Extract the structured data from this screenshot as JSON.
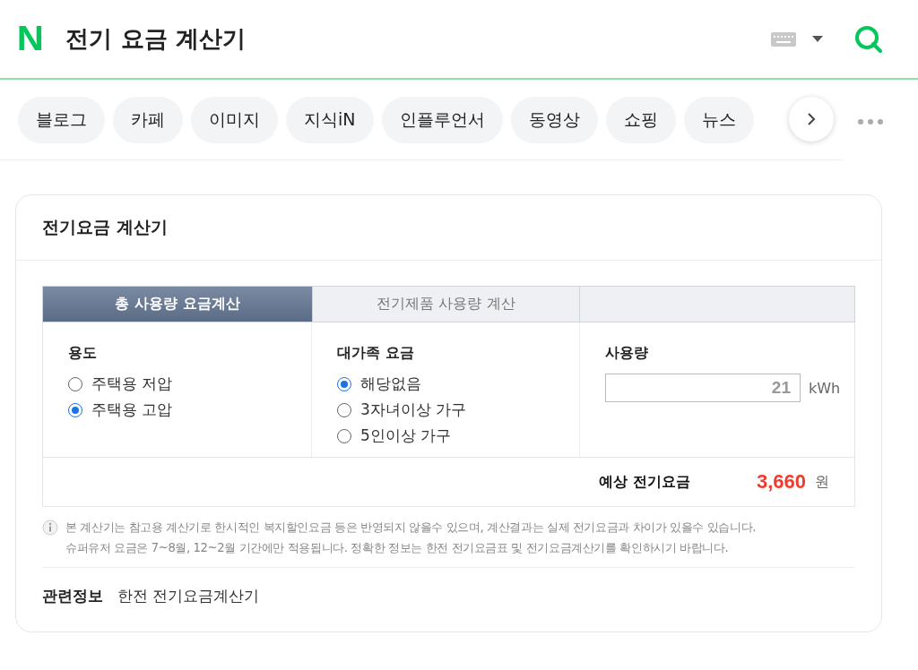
{
  "header": {
    "logo": "N",
    "query": "전기 요금 계산기"
  },
  "chips": [
    {
      "label": "블로그"
    },
    {
      "label": "카페"
    },
    {
      "label": "이미지"
    },
    {
      "label": "지식iN"
    },
    {
      "label": "인플루언서"
    },
    {
      "label": "동영상"
    },
    {
      "label": "쇼핑"
    },
    {
      "label": "뉴스"
    }
  ],
  "card": {
    "title": "전기요금 계산기",
    "tabs": [
      {
        "label": "총 사용량 요금계산",
        "selected": true
      },
      {
        "label": "전기제품 사용량 계산",
        "selected": false
      },
      {
        "selected": false
      }
    ],
    "usage_type": {
      "label": "용도",
      "options": [
        {
          "label": "주택용 저압",
          "selected": false
        },
        {
          "label": "주택용 고압",
          "selected": true
        }
      ]
    },
    "family": {
      "label": "대가족 요금",
      "options": [
        {
          "label": "해당없음",
          "selected": true
        },
        {
          "label": "3자녀이상 가구",
          "selected": false
        },
        {
          "label": "5인이상 가구",
          "selected": false
        }
      ]
    },
    "amount": {
      "label": "사용량",
      "value": "21",
      "unit": "kWh"
    },
    "result": {
      "label": "예상 전기요금",
      "value": "3,660",
      "unit": "원"
    },
    "notes": [
      "본 계산기는 참고용 계산기로 한시적인 복지할인요금 등은 반영되지 않을수 있으며, 계산결과는 실제 전기요금과 차이가 있을수 있습니다.",
      "슈퍼유저 요금은 7~8월, 12~2월 기간에만 적용됩니다. 정확한 정보는 한전 전기요금표 및 전기요금계산기를 확인하시기 바랍니다."
    ],
    "related": {
      "label": "관련정보",
      "link": "한전 전기요금계산기"
    }
  }
}
